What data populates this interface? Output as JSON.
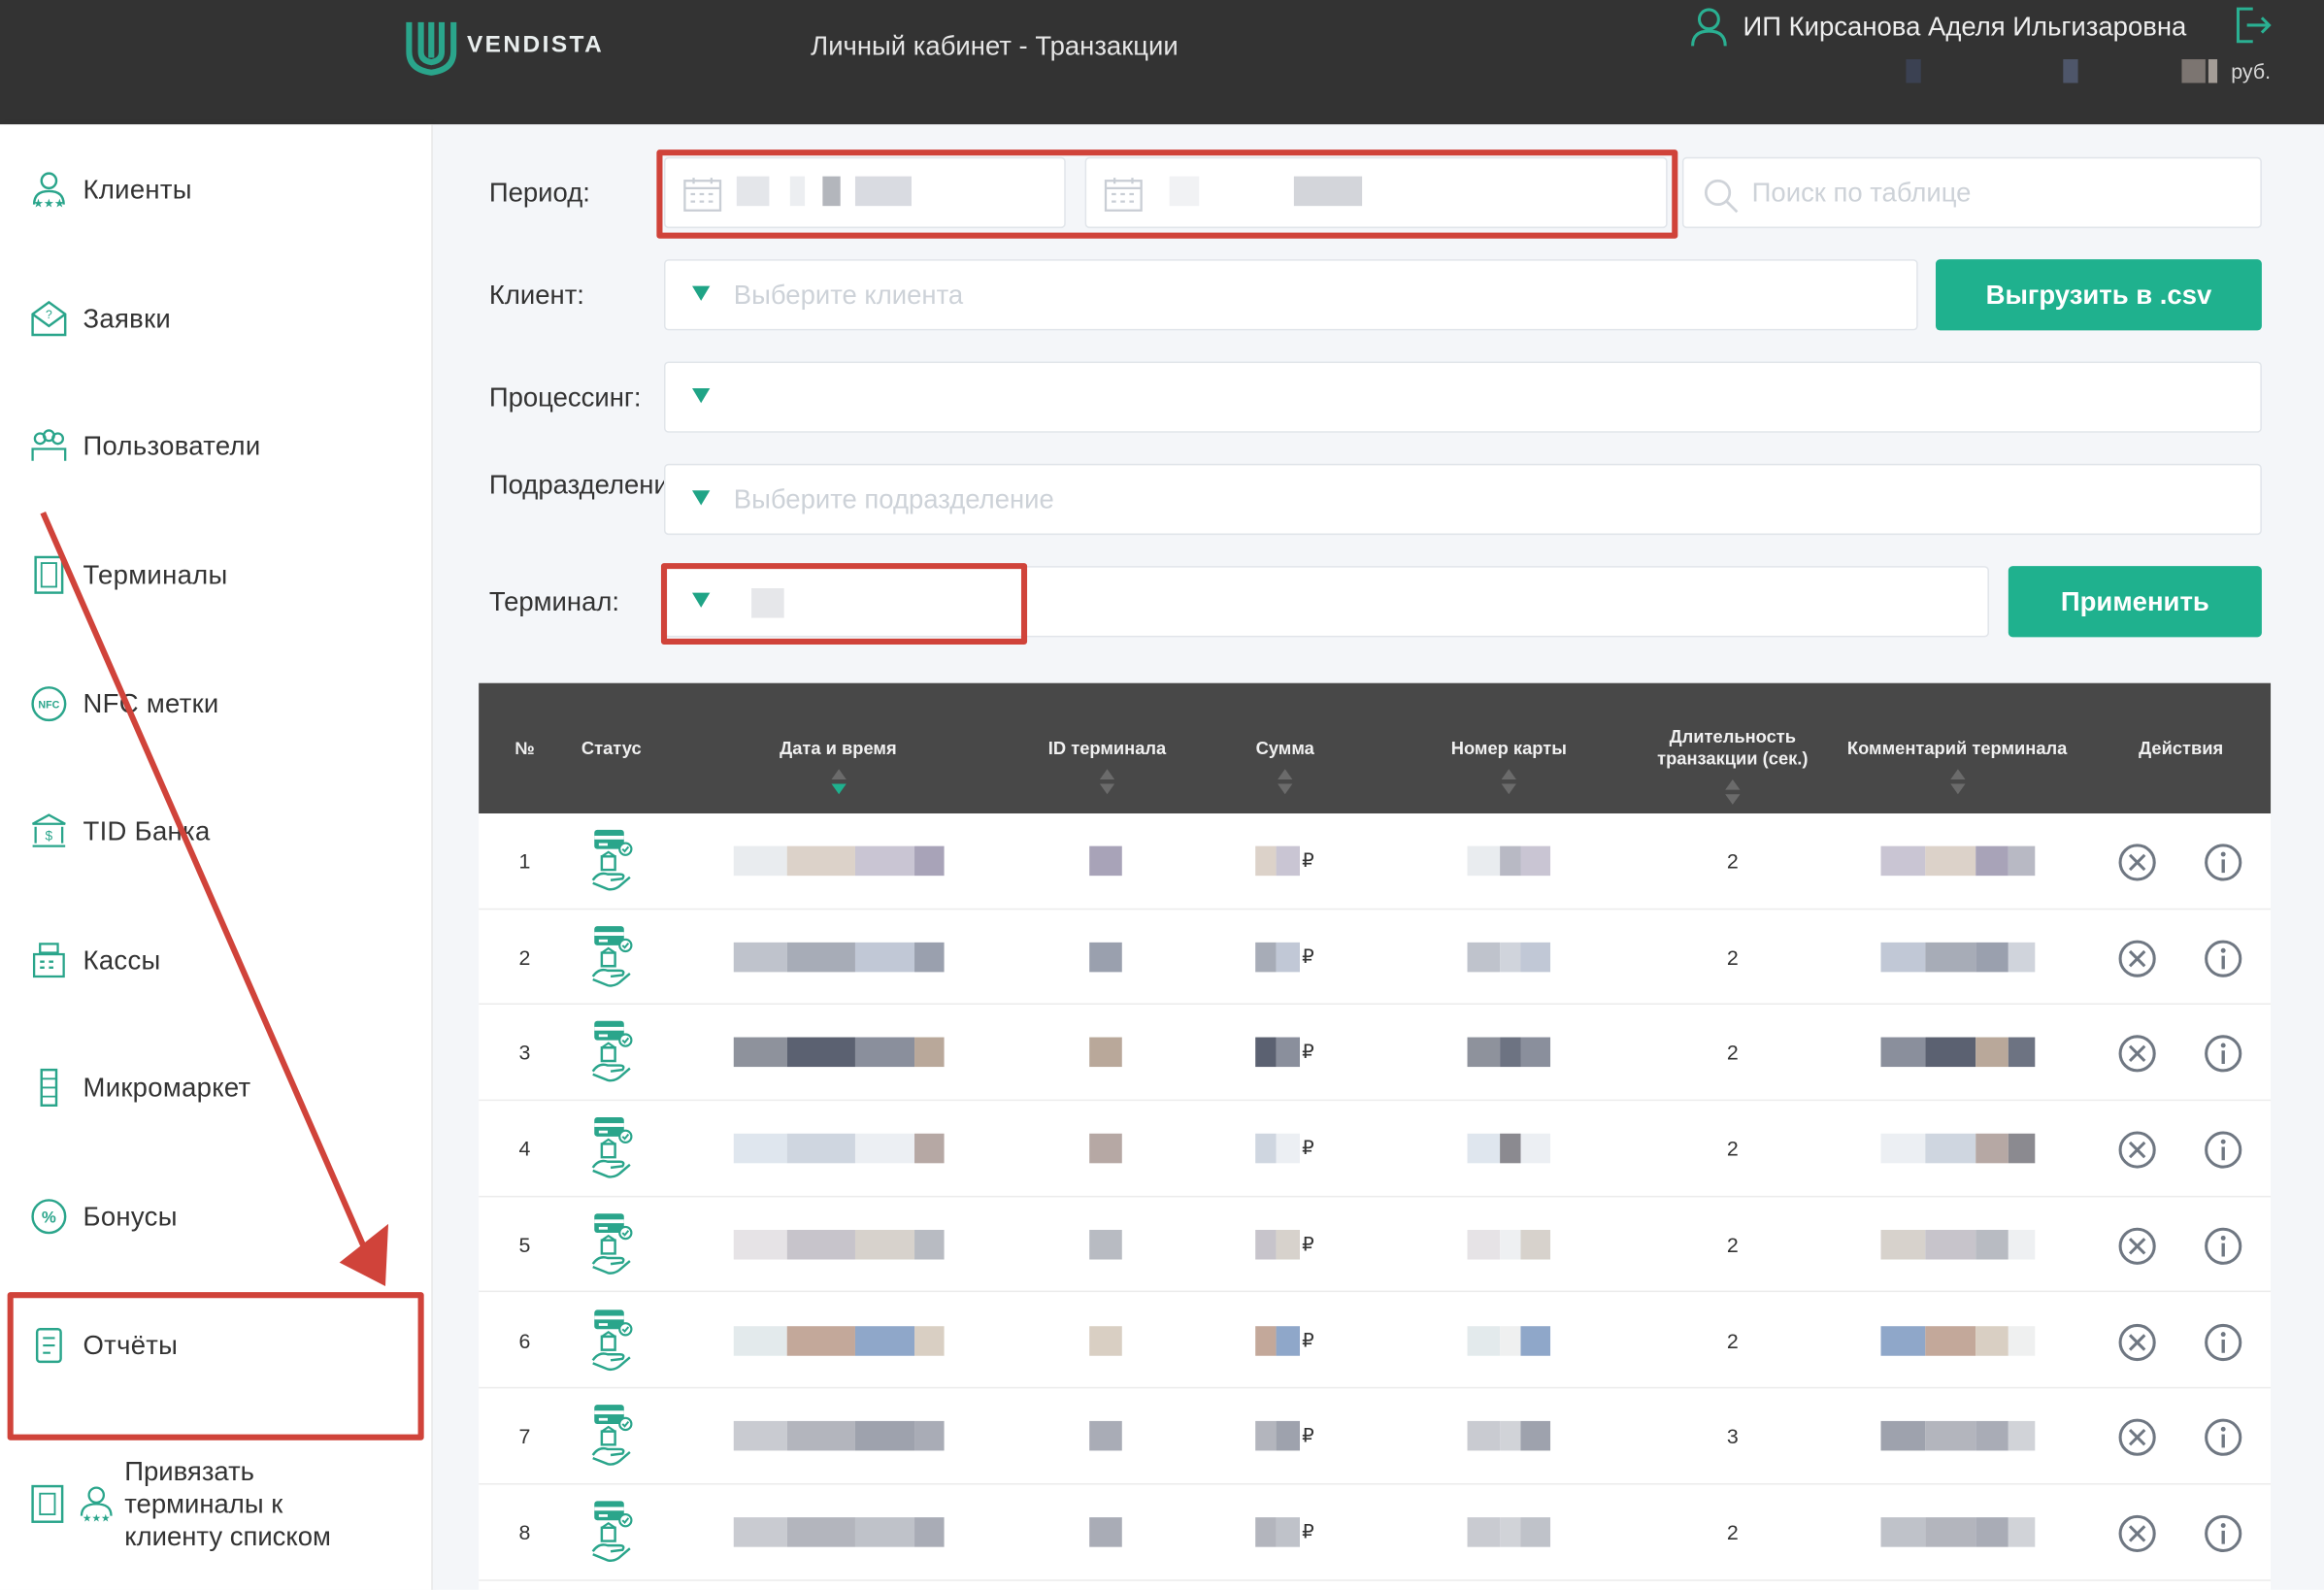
{
  "header": {
    "brand": "VENDISTA",
    "page_title": "Личный кабинет - Транзакции",
    "user_name": "ИП Кирсанова Аделя Ильгизаровна",
    "currency": "руб."
  },
  "sidebar": {
    "items": [
      {
        "label": "Клиенты",
        "icon": "clients-icon"
      },
      {
        "label": "Заявки",
        "icon": "requests-icon"
      },
      {
        "label": "Пользователи",
        "icon": "users-icon"
      },
      {
        "label": "Терминалы",
        "icon": "terminal-icon"
      },
      {
        "label": "NFC метки",
        "icon": "nfc-icon"
      },
      {
        "label": "TID Банка",
        "icon": "bank-icon"
      },
      {
        "label": "Кассы",
        "icon": "cash-register-icon"
      },
      {
        "label": "Микромаркет",
        "icon": "micromarket-icon"
      },
      {
        "label": "Бонусы",
        "icon": "bonus-icon"
      },
      {
        "label": "Отчёты",
        "icon": "reports-icon"
      }
    ],
    "bind_terminals": "Привязать терминалы к клиенту списком"
  },
  "filters": {
    "period_label": "Период:",
    "client_label": "Клиент:",
    "client_placeholder": "Выберите клиента",
    "processing_label": "Процессинг:",
    "division_label": "Подразделение:",
    "division_placeholder": "Выберите подразделение",
    "terminal_label": "Терминал:",
    "search_placeholder": "Поиск по таблице",
    "export_button": "Выгрузить в .csv",
    "apply_button": "Применить"
  },
  "table": {
    "columns": [
      "№",
      "Статус",
      "Дата и время",
      "ID терминала",
      "Сумма",
      "Номер карты",
      "Длительность транзакции (сек.)",
      "Комментарий терминала",
      "Действия"
    ],
    "sum_suffix": "₽",
    "rows": [
      {
        "n": "1",
        "duration": "2"
      },
      {
        "n": "2",
        "duration": "2"
      },
      {
        "n": "3",
        "duration": "2"
      },
      {
        "n": "4",
        "duration": "2"
      },
      {
        "n": "5",
        "duration": "2"
      },
      {
        "n": "6",
        "duration": "2"
      },
      {
        "n": "7",
        "duration": "3"
      },
      {
        "n": "8",
        "duration": "2"
      }
    ]
  },
  "colors": {
    "accent": "#1fb18e",
    "topbar": "#333333",
    "highlight": "#d0433a"
  }
}
